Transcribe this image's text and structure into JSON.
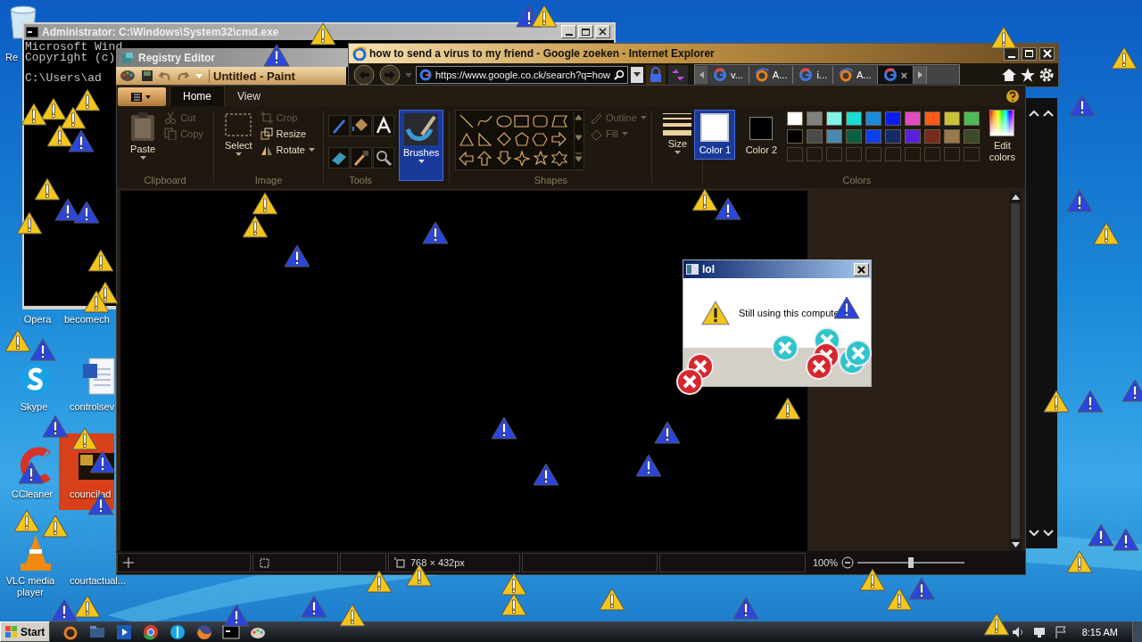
{
  "desktop_icons": [
    {
      "label": "Re",
      "kind": "bin"
    },
    {
      "label": "Opera",
      "kind": "none"
    },
    {
      "label": "becomech",
      "kind": "none"
    },
    {
      "label": "Skype",
      "kind": "skype"
    },
    {
      "label": "controlsev",
      "kind": "word"
    },
    {
      "label": "CCleaner",
      "kind": "ccleaner"
    },
    {
      "label": "councilad",
      "kind": "thumb"
    },
    {
      "label": "VLC media player",
      "kind": "vlc"
    },
    {
      "label": "courtactual...",
      "kind": "none"
    }
  ],
  "cmd": {
    "title": "Administrator: C:\\Windows\\System32\\cmd.exe",
    "lines": [
      "Microsoft Wind",
      "Copyright (c)",
      "C:\\Users\\ad"
    ]
  },
  "regedit": {
    "title": "Registry Editor"
  },
  "ie": {
    "title": "how to send a virus to my friend - Google zoeken - Internet Explorer",
    "url": "https://www.google.co.ck/search?q=how",
    "tabs": [
      {
        "label": "v...",
        "kind": "google",
        "selected": false
      },
      {
        "label": "A...",
        "kind": "ie",
        "selected": false
      },
      {
        "label": "i...",
        "kind": "google",
        "selected": false
      },
      {
        "label": "A...",
        "kind": "ie",
        "selected": false
      },
      {
        "close": "×",
        "kind": "google",
        "selected": true
      }
    ]
  },
  "paint": {
    "title": "Untitled - Paint",
    "tabs": [
      {
        "label": "Home",
        "selected": true
      },
      {
        "label": "View",
        "selected": false
      }
    ],
    "clipboard": {
      "label": "Clipboard",
      "paste": "Paste",
      "tools": [
        {
          "label": "Cut",
          "kind": "cut",
          "disabled": true
        },
        {
          "label": "Copy",
          "kind": "copy",
          "disabled": true
        }
      ]
    },
    "image": {
      "label": "Image",
      "select": "Select",
      "tools": [
        {
          "label": "Crop",
          "kind": "crop",
          "disabled": true
        },
        {
          "label": "Resize",
          "kind": "resize",
          "disabled": false
        },
        {
          "label": "Rotate",
          "kind": "rotate",
          "disabled": false
        }
      ]
    },
    "tools_group": {
      "label": "Tools"
    },
    "brushes": {
      "label": "Brushes",
      "selected": true
    },
    "shapes": {
      "label": "Shapes",
      "outline": {
        "label": "Outline",
        "disabled": true
      },
      "fill": {
        "label": "Fill",
        "disabled": true
      }
    },
    "size": {
      "label": "Size"
    },
    "colors": {
      "label": "Colors",
      "edit": "Edit colors",
      "slots": [
        {
          "label": "Color 1",
          "color": "#ffffff",
          "selected": true
        },
        {
          "label": "Color 2",
          "color": "#000000",
          "selected": false
        }
      ],
      "palette": [
        {
          "kind": "swatch",
          "color": "#ffffff"
        },
        {
          "kind": "swatch",
          "color": "#808080"
        },
        {
          "kind": "swatch",
          "color": "#7ef5e6"
        },
        {
          "kind": "swatch",
          "color": "#19dcd2"
        },
        {
          "kind": "swatch",
          "color": "#1a8adc"
        },
        {
          "kind": "swatch",
          "color": "#0a1ef0"
        },
        {
          "kind": "swatch",
          "color": "#e04cc0"
        },
        {
          "kind": "swatch",
          "color": "#ff5a1a"
        },
        {
          "kind": "swatch",
          "color": "#c8c03a"
        },
        {
          "kind": "swatch",
          "color": "#50b858"
        },
        {
          "kind": "swatch",
          "color": "#000000"
        },
        {
          "kind": "swatch",
          "color": "#4a4a4a"
        },
        {
          "kind": "swatch",
          "color": "#4a8ab0"
        },
        {
          "kind": "swatch",
          "color": "#0a6040"
        },
        {
          "kind": "swatch",
          "color": "#0a40f0"
        },
        {
          "kind": "swatch",
          "color": "#142a6a"
        },
        {
          "kind": "swatch",
          "color": "#5a20e0"
        },
        {
          "kind": "swatch",
          "color": "#7a2a1a"
        },
        {
          "kind": "swatch",
          "color": "#9a7a4a"
        },
        {
          "kind": "swatch",
          "color": "#3a4a2a"
        },
        {
          "kind": "empty"
        },
        {
          "kind": "empty"
        },
        {
          "kind": "empty"
        },
        {
          "kind": "empty"
        },
        {
          "kind": "empty"
        },
        {
          "kind": "empty"
        },
        {
          "kind": "empty"
        },
        {
          "kind": "empty"
        },
        {
          "kind": "empty"
        },
        {
          "kind": "empty"
        }
      ]
    },
    "status": {
      "dimensions": "768 × 432px",
      "zoom": "100%",
      "level": 0.5
    }
  },
  "dialog": {
    "title": "lol",
    "message": "Still using this compute"
  },
  "taskbar": {
    "start": "Start",
    "clock": "8:15 AM",
    "apps": [
      {
        "kind": "ie"
      },
      {
        "kind": "folder"
      },
      {
        "kind": "media"
      },
      {
        "kind": "chrome"
      },
      {
        "kind": "blue"
      },
      {
        "kind": "firefox"
      },
      {
        "kind": "cmd"
      },
      {
        "kind": "paint"
      }
    ]
  },
  "warning_icons": [
    {
      "color": "#f5c518"
    },
    {
      "color": "#2a45e0"
    },
    {
      "color": "#2a45e0"
    },
    {
      "color": "#f5c518"
    },
    {
      "color": "#f5c518"
    },
    {
      "color": "#f5c518"
    },
    {
      "color": "#f5c518"
    },
    {
      "color": "#f5c518"
    },
    {
      "color": "#f5c518"
    },
    {
      "color": "#f5c518"
    },
    {
      "color": "#f5c518"
    },
    {
      "color": "#2a45e0"
    },
    {
      "color": "#f5c518"
    },
    {
      "color": "#2a45e0"
    },
    {
      "color": "#2a45e0"
    },
    {
      "color": "#f5c518"
    },
    {
      "color": "#f5c518"
    },
    {
      "color": "#f5c518"
    },
    {
      "color": "#2a45e0"
    },
    {
      "color": "#f5c518"
    },
    {
      "color": "#2a45e0"
    },
    {
      "color": "#f5c518"
    },
    {
      "color": "#2a45e0"
    },
    {
      "color": "#2a45e0"
    },
    {
      "color": "#2a45e0"
    },
    {
      "color": "#f5c518"
    },
    {
      "color": "#f5c518"
    },
    {
      "color": "#f5c518"
    },
    {
      "color": "#f5c518"
    },
    {
      "color": "#2a45e0"
    },
    {
      "color": "#2a45e0"
    },
    {
      "color": "#2a45e0"
    },
    {
      "color": "#f5c518"
    },
    {
      "color": "#2a45e0"
    },
    {
      "color": "#2a45e0"
    },
    {
      "color": "#2a45e0"
    },
    {
      "color": "#2a45e0"
    },
    {
      "color": "#f5c518"
    },
    {
      "color": "#2a45e0"
    },
    {
      "color": "#f5c518"
    },
    {
      "color": "#2a45e0"
    },
    {
      "color": "#2a45e0"
    },
    {
      "color": "#2a45e0"
    },
    {
      "color": "#f5c518"
    },
    {
      "color": "#2a45e0"
    },
    {
      "color": "#2a45e0"
    },
    {
      "color": "#f5c518"
    },
    {
      "color": "#f5c518"
    },
    {
      "color": "#2a45e0"
    },
    {
      "color": "#f5c518"
    },
    {
      "color": "#2a45e0"
    },
    {
      "color": "#2a45e0"
    },
    {
      "color": "#f5c518"
    },
    {
      "color": "#f5c518"
    },
    {
      "color": "#f5c518"
    },
    {
      "color": "#f5c518"
    },
    {
      "color": "#f5c518"
    },
    {
      "color": "#f5c518"
    },
    {
      "color": "#2a45e0"
    },
    {
      "color": "#f5c518"
    },
    {
      "color": "#f5c518"
    },
    {
      "color": "#2a45e0"
    },
    {
      "color": "#f5c518"
    },
    {
      "color": "#2a45e0"
    }
  ],
  "error_icons": [
    {
      "color": "#d8262e"
    },
    {
      "color": "#d8262e"
    },
    {
      "color": "#30c4cc"
    },
    {
      "color": "#30c4cc"
    },
    {
      "color": "#d8262e"
    },
    {
      "color": "#30c4cc"
    },
    {
      "color": "#30c4cc"
    },
    {
      "color": "#d8262e"
    }
  ]
}
